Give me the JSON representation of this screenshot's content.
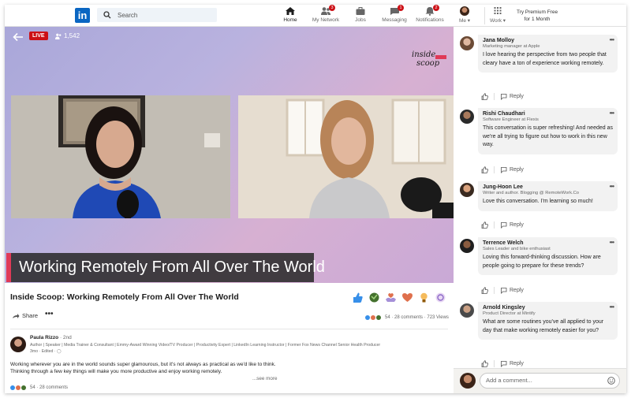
{
  "nav": {
    "search_placeholder": "Search",
    "items": [
      {
        "label": "Home",
        "badge": ""
      },
      {
        "label": "My Network",
        "badge": "3"
      },
      {
        "label": "Jobs",
        "badge": ""
      },
      {
        "label": "Messaging",
        "badge": "1"
      },
      {
        "label": "Notifications",
        "badge": "2"
      },
      {
        "label": "Me ▾",
        "badge": ""
      },
      {
        "label": "Work ▾",
        "badge": ""
      }
    ],
    "premium_line1": "Try Premium Free",
    "premium_line2": "for 1 Month"
  },
  "video": {
    "live_label": "LIVE",
    "viewer_count": "1,542",
    "brand_line1": "inside",
    "brand_line2": "scoop",
    "lower_third": "Working Remotely From All Over The World"
  },
  "post": {
    "title": "Inside Scoop: Working Remotely From All Over The World",
    "share_label": "Share",
    "more_label": "•••",
    "stats": "54 · 28 comments · 723 Views",
    "author": {
      "name": "Paula Rizzo",
      "degree": "· 2nd",
      "headline": "Author | Speaker | Media Trainer & Consultant | Emmy-Award Winning Video/TV Producer | Productivity Expert | LinkedIn Learning Instructor | Former Fox News Channel Senior Health Producer",
      "time": "3mo · Edited ·"
    },
    "body_line1": "Working wherever you are in the world sounds super glamourous, but it's not always as practical as we'd like to think.",
    "body_line2": "Thinking through a few key things will make you more productive and enjoy working remotely.",
    "see_more": "...see more",
    "bottom_stats": "54 · 28 comments"
  },
  "comments": [
    {
      "name": "Jana Molloy",
      "role": "Marketing manager at Apple",
      "text": "I love hearing the perspective from two people that cleary have a ton of experience working remotely.",
      "reply_label": "Reply"
    },
    {
      "name": "Rishi Chaudhari",
      "role": "Software Engineer at Flexis",
      "text": "This conversation is super refreshing! And needed as we're all trying to figure out how to work in this new way.",
      "reply_label": "Reply"
    },
    {
      "name": "Jung-Hoon Lee",
      "role": "Writer and author. Blogging @ RemoteWork.Co",
      "text": "Love this conversation. I'm learning so much!",
      "reply_label": "Reply"
    },
    {
      "name": "Terrence Welch",
      "role": "Sales Leader and bike enthusiast",
      "text": "Loving this forward-thinking discussion. How are people going to prepare for these trends?",
      "reply_label": "Reply"
    },
    {
      "name": "Arnold Kingsley",
      "role": "Product Director at Mintify",
      "text": "What are some routines you've all applied to your day that make working remotely easier for you?",
      "reply_label": "Reply"
    }
  ],
  "composer": {
    "placeholder": "Add a comment..."
  },
  "colors": {
    "brand_blue": "#0a66c2",
    "live_red": "#cc1016",
    "accent_pink": "#e03a57"
  }
}
